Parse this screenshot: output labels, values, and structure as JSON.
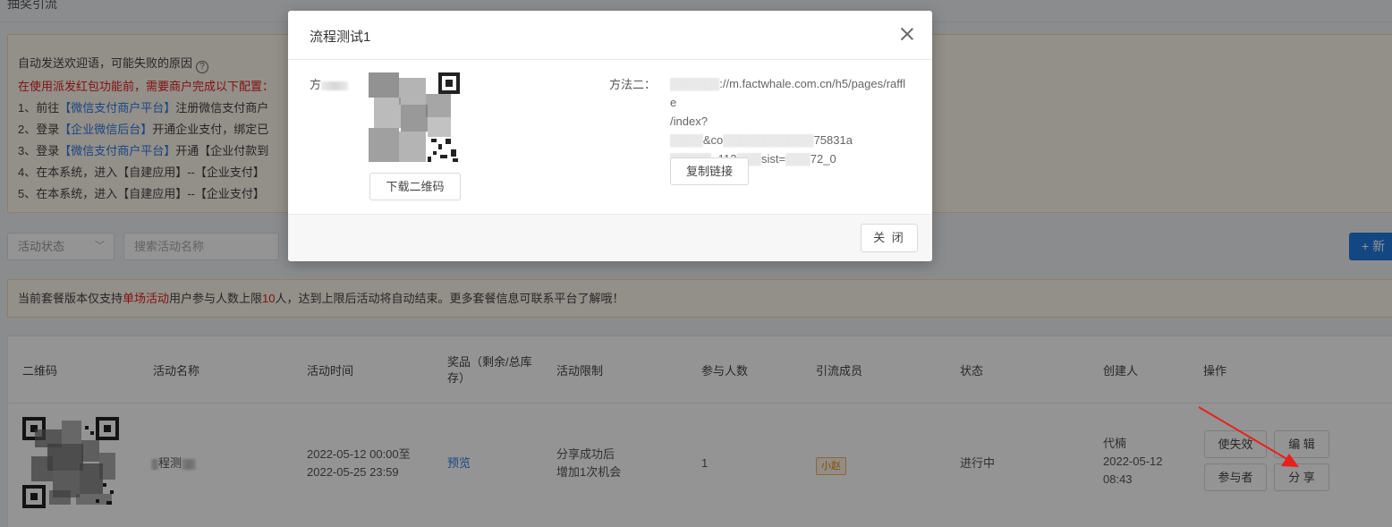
{
  "page": {
    "title": "抽奖引流"
  },
  "notice": {
    "heading": "自动发送欢迎语，可能失败的原因",
    "help_icon": "?",
    "warning": "在使用派发红包功能前，需要商户完成以下配置：",
    "steps": [
      {
        "prefix": "1、前往",
        "link": "【微信支付商户平台】",
        "suffix": "注册微信支付商户"
      },
      {
        "prefix": "2、登录",
        "link": "【企业微信后台】",
        "suffix": "开通企业支付，绑定已"
      },
      {
        "prefix": "3、登录",
        "link": "【微信支付商户平台】",
        "suffix": "开通【企业付款到"
      },
      {
        "prefix": "4、在本系统，进入【自建应用】--【企业支付】",
        "link": "",
        "suffix": ""
      },
      {
        "prefix": "5、在本系统，进入【自建应用】--【企业支付】",
        "link": "",
        "suffix": ""
      }
    ]
  },
  "filters": {
    "status_placeholder": "活动状态",
    "search_placeholder": "搜索活动名称",
    "new_button": "+ 新"
  },
  "package_notice": {
    "p1": "当前套餐版本仅支持",
    "p2": "单场活动",
    "p3": "用户参与人数上限",
    "p4": "10",
    "p5": "人，达到上限后活动将自动结束。更多套餐信息可联系平台了解哦！"
  },
  "table": {
    "headers": [
      "二维码",
      "活动名称",
      "活动时间",
      "奖品（剩余/总库存）",
      "活动限制",
      "参与人数",
      "引流成员",
      "状态",
      "创建人",
      "操作"
    ],
    "row": {
      "name": "程测",
      "time_start": "2022-05-12 00:00至",
      "time_end": "2022-05-25 23:59",
      "prize": "预览",
      "limit_l1": "分享成功后",
      "limit_l2": "增加1次机会",
      "participants": "1",
      "member": "小赵",
      "status": "进行中",
      "creator": "代楠",
      "created_date": "2022-05-12",
      "created_time": "08:43",
      "ops": {
        "invalidate": "使失效",
        "edit": "编 辑",
        "participants": "参与者",
        "share": "分 享"
      }
    }
  },
  "modal": {
    "title": "流程测试1",
    "method1_label": "方",
    "download_qr": "下载二维码",
    "method2_label": "方法二：",
    "url_line1": "://m.factwhale.com.cn/h5/pages/raffle",
    "url_line2": "/index?",
    "url_line3": "&co",
    "url_line3b": "75831a",
    "url_line4": "=112",
    "url_line4b": "sist=",
    "url_line4c": "72_0",
    "copy_link": "复制链接",
    "close": "关 闭"
  },
  "colors": {
    "accent": "#1f7ae0",
    "warning_red": "#e02020",
    "link_blue": "#2d7be4",
    "arrow_red": "#e8201b"
  }
}
